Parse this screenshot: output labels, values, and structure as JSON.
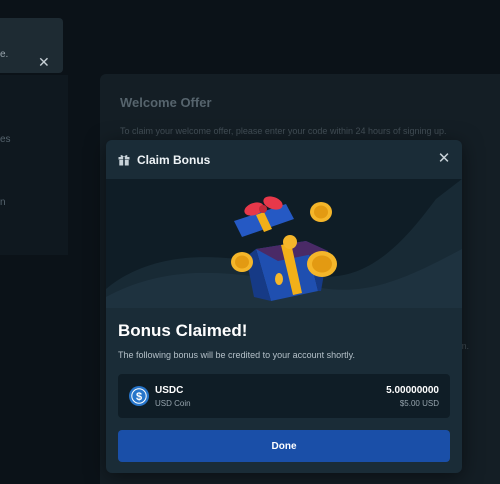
{
  "background": {
    "toast_text": "e.",
    "toast_close": "✕",
    "left_fragments": [
      "es",
      "n"
    ],
    "card_title": "Welcome Offer",
    "card_desc": "To claim your welcome offer, please enter your code within 24 hours of signing up.",
    "card_right_fragment": "m."
  },
  "modal": {
    "title": "Claim Bonus",
    "close_glyph": "✕",
    "heading": "Bonus Claimed!",
    "description": "The following bonus will be credited to your account shortly.",
    "bonus": {
      "symbol": "USDC",
      "name": "USD Coin",
      "amount": "5.00000000",
      "usd_value": "$5.00 USD",
      "icon": "usdc-coin-icon"
    },
    "done_label": "Done"
  },
  "colors": {
    "page_bg": "#0b1218",
    "modal_bg": "#1a2c37",
    "banner_bg": "#0f1d26",
    "primary_button": "#1a4fa8",
    "usdc_blue": "#2775ca"
  }
}
